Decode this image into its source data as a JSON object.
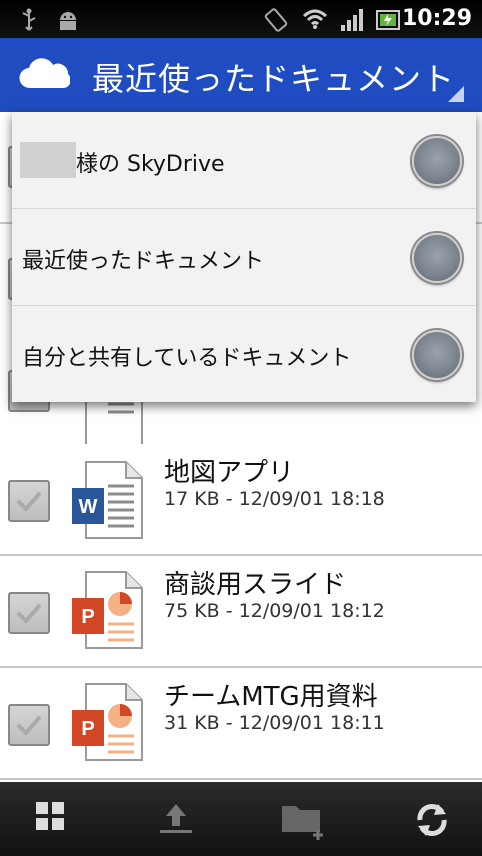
{
  "statusbar": {
    "time": "10:29",
    "icons": [
      "usb-icon",
      "android-debug-icon",
      "rotation-icon",
      "wifi-icon",
      "signal-icon",
      "battery-icon"
    ]
  },
  "header": {
    "title": "最近使ったドキュメント",
    "icon": "skydrive-cloud-icon",
    "color": "#1f4cc0"
  },
  "dropdown": {
    "items": [
      {
        "label": "様の SkyDrive",
        "selected": false
      },
      {
        "label": "最近使ったドキュメント",
        "selected": false
      },
      {
        "label": "自分と共有しているドキュメント",
        "selected": false
      }
    ]
  },
  "files": [
    {
      "name": "地図アプリ",
      "meta": "17 KB - 12/09/01 18:18",
      "type": "word"
    },
    {
      "name": "商談用スライド",
      "meta": "75 KB - 12/09/01 18:12",
      "type": "powerpoint"
    },
    {
      "name": "チームMTG用資料",
      "meta": "31 KB - 12/09/01 18:11",
      "type": "powerpoint"
    }
  ],
  "bottombar": {
    "buttons": [
      "grid-view-icon",
      "upload-icon",
      "new-folder-icon",
      "refresh-icon"
    ]
  }
}
